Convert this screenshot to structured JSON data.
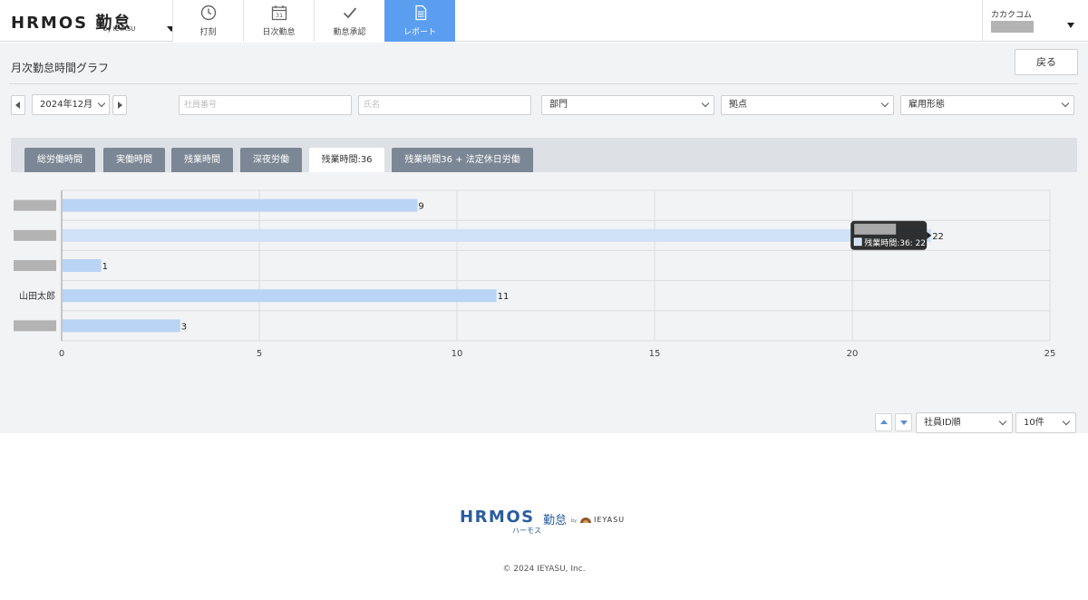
{
  "header": {
    "logo_main": "HRMOS 勤怠",
    "logo_sub": "by IEYASU",
    "nav": [
      {
        "label": "打刻",
        "icon": "clock-icon"
      },
      {
        "label": "日次勤怠",
        "icon": "calendar-icon"
      },
      {
        "label": "勤怠承認",
        "icon": "checkmark-icon"
      },
      {
        "label": "レポート",
        "icon": "document-icon",
        "active": true
      }
    ],
    "account_name": "カカクコム"
  },
  "page": {
    "title": "月次勤怠時間グラフ",
    "back_label": "戻る"
  },
  "filters": {
    "month": "2024年12月",
    "employee_number_placeholder": "社員番号",
    "name_placeholder": "氏名",
    "department": "部門",
    "location": "拠点",
    "employment_type": "雇用形態"
  },
  "tabs": [
    {
      "label": "総労働時間"
    },
    {
      "label": "実働時間"
    },
    {
      "label": "残業時間"
    },
    {
      "label": "深夜労働"
    },
    {
      "label": "残業時間:36",
      "active": true
    },
    {
      "label": "残業時間36 + 法定休日労働"
    }
  ],
  "chart_data": {
    "type": "bar",
    "orientation": "horizontal",
    "categories": [
      "",
      "",
      "",
      "山田太郎",
      ""
    ],
    "values": [
      9,
      22,
      1,
      11,
      3
    ],
    "xlim": [
      0,
      25
    ],
    "xticks": [
      0,
      5,
      10,
      15,
      20,
      25
    ],
    "grid": true,
    "bar_color": "#b9d4f5",
    "highlight_color": "#cfe1f7",
    "tooltip": {
      "category_index": 1,
      "series_label": "残業時間:36",
      "value": 22
    }
  },
  "sort": {
    "order": "社員ID順",
    "per_page": "10件"
  },
  "footer": {
    "logo_main": "HRMOS",
    "logo_kintai": "勤怠",
    "logo_kana": "ハーモス",
    "logo_by": "by",
    "logo_ieyasu": "IEYASU",
    "copyright": "© 2024 IEYASU, Inc."
  }
}
